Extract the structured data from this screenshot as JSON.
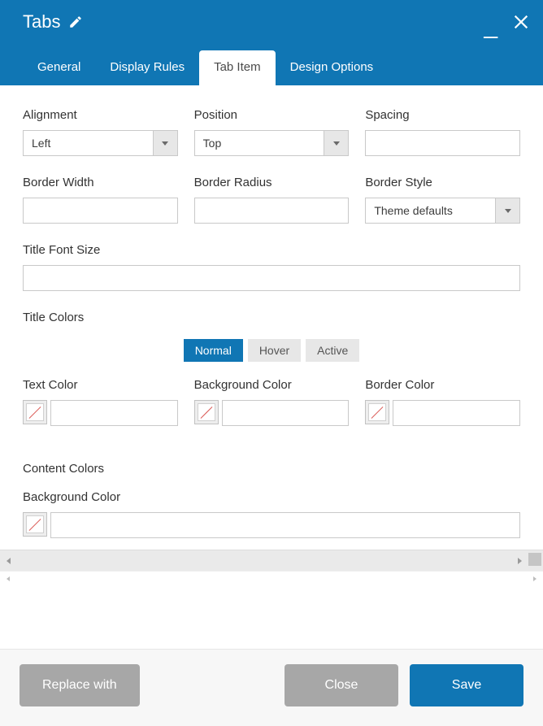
{
  "header": {
    "title": "Tabs"
  },
  "tabs": [
    {
      "label": "General",
      "active": false
    },
    {
      "label": "Display Rules",
      "active": false
    },
    {
      "label": "Tab Item",
      "active": true
    },
    {
      "label": "Design Options",
      "active": false
    }
  ],
  "fields": {
    "alignment": {
      "label": "Alignment",
      "value": "Left"
    },
    "position": {
      "label": "Position",
      "value": "Top"
    },
    "spacing": {
      "label": "Spacing",
      "value": ""
    },
    "border_width": {
      "label": "Border Width",
      "value": ""
    },
    "border_radius": {
      "label": "Border Radius",
      "value": ""
    },
    "border_style": {
      "label": "Border Style",
      "value": "Theme defaults"
    },
    "title_font_size": {
      "label": "Title Font Size",
      "value": ""
    }
  },
  "title_colors": {
    "section_label": "Title Colors",
    "states": [
      {
        "label": "Normal",
        "active": true
      },
      {
        "label": "Hover",
        "active": false
      },
      {
        "label": "Active",
        "active": false
      }
    ],
    "text_color": {
      "label": "Text Color",
      "value": ""
    },
    "background_color": {
      "label": "Background Color",
      "value": ""
    },
    "border_color": {
      "label": "Border Color",
      "value": ""
    }
  },
  "content_colors": {
    "section_label": "Content Colors",
    "background_color": {
      "label": "Background Color",
      "value": ""
    }
  },
  "footer": {
    "replace_with": "Replace with",
    "close": "Close",
    "save": "Save"
  }
}
